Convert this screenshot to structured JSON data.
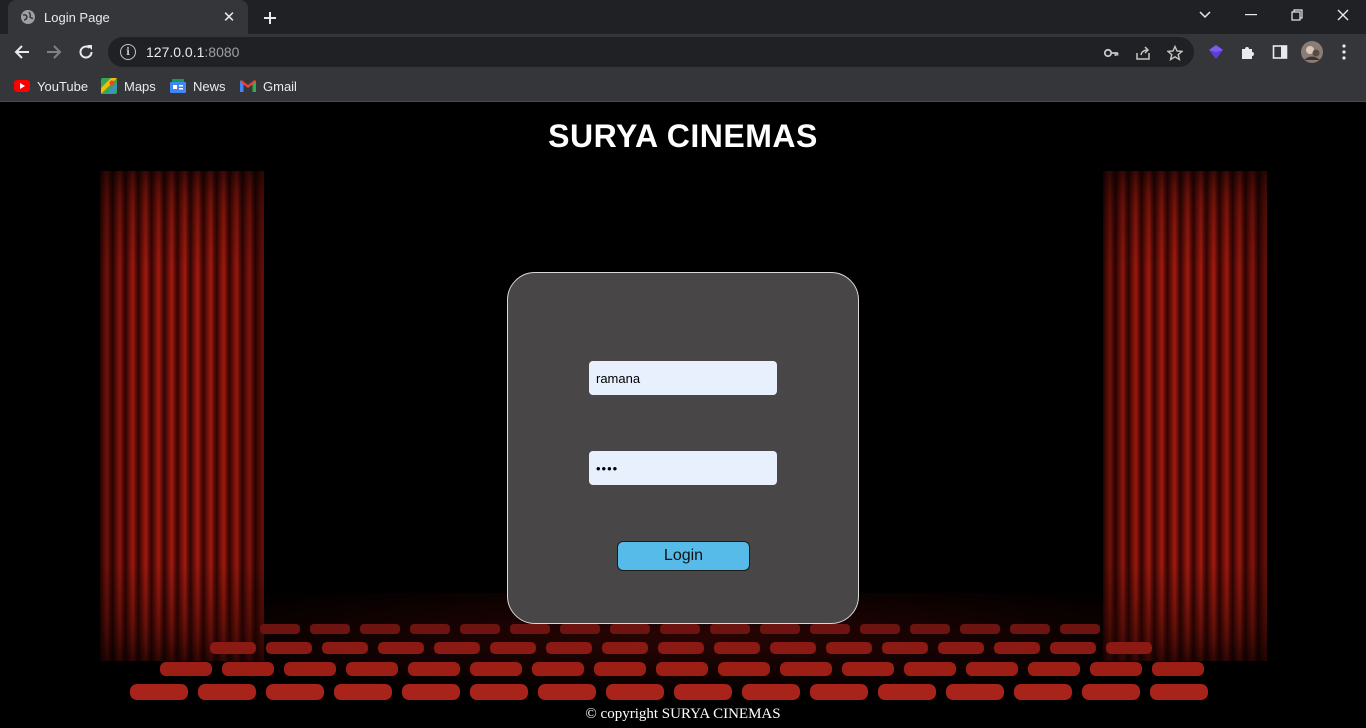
{
  "browser": {
    "tab_title": "Login Page",
    "url_host": "127.0.0.1",
    "url_port": ":8080",
    "bookmarks": [
      {
        "label": "YouTube",
        "icon": "youtube-icon"
      },
      {
        "label": "Maps",
        "icon": "maps-icon"
      },
      {
        "label": "News",
        "icon": "news-icon"
      },
      {
        "label": "Gmail",
        "icon": "gmail-icon"
      }
    ]
  },
  "page": {
    "title": "SURYA CINEMAS",
    "username_value": "ramana",
    "password_value": "••••",
    "login_label": "Login",
    "footer": "© copyright SURYA CINEMAS"
  },
  "colors": {
    "login_box": "#484647",
    "login_button": "#57bbea",
    "input_bg": "#e8f0fe",
    "curtain": "#8b1a10"
  }
}
